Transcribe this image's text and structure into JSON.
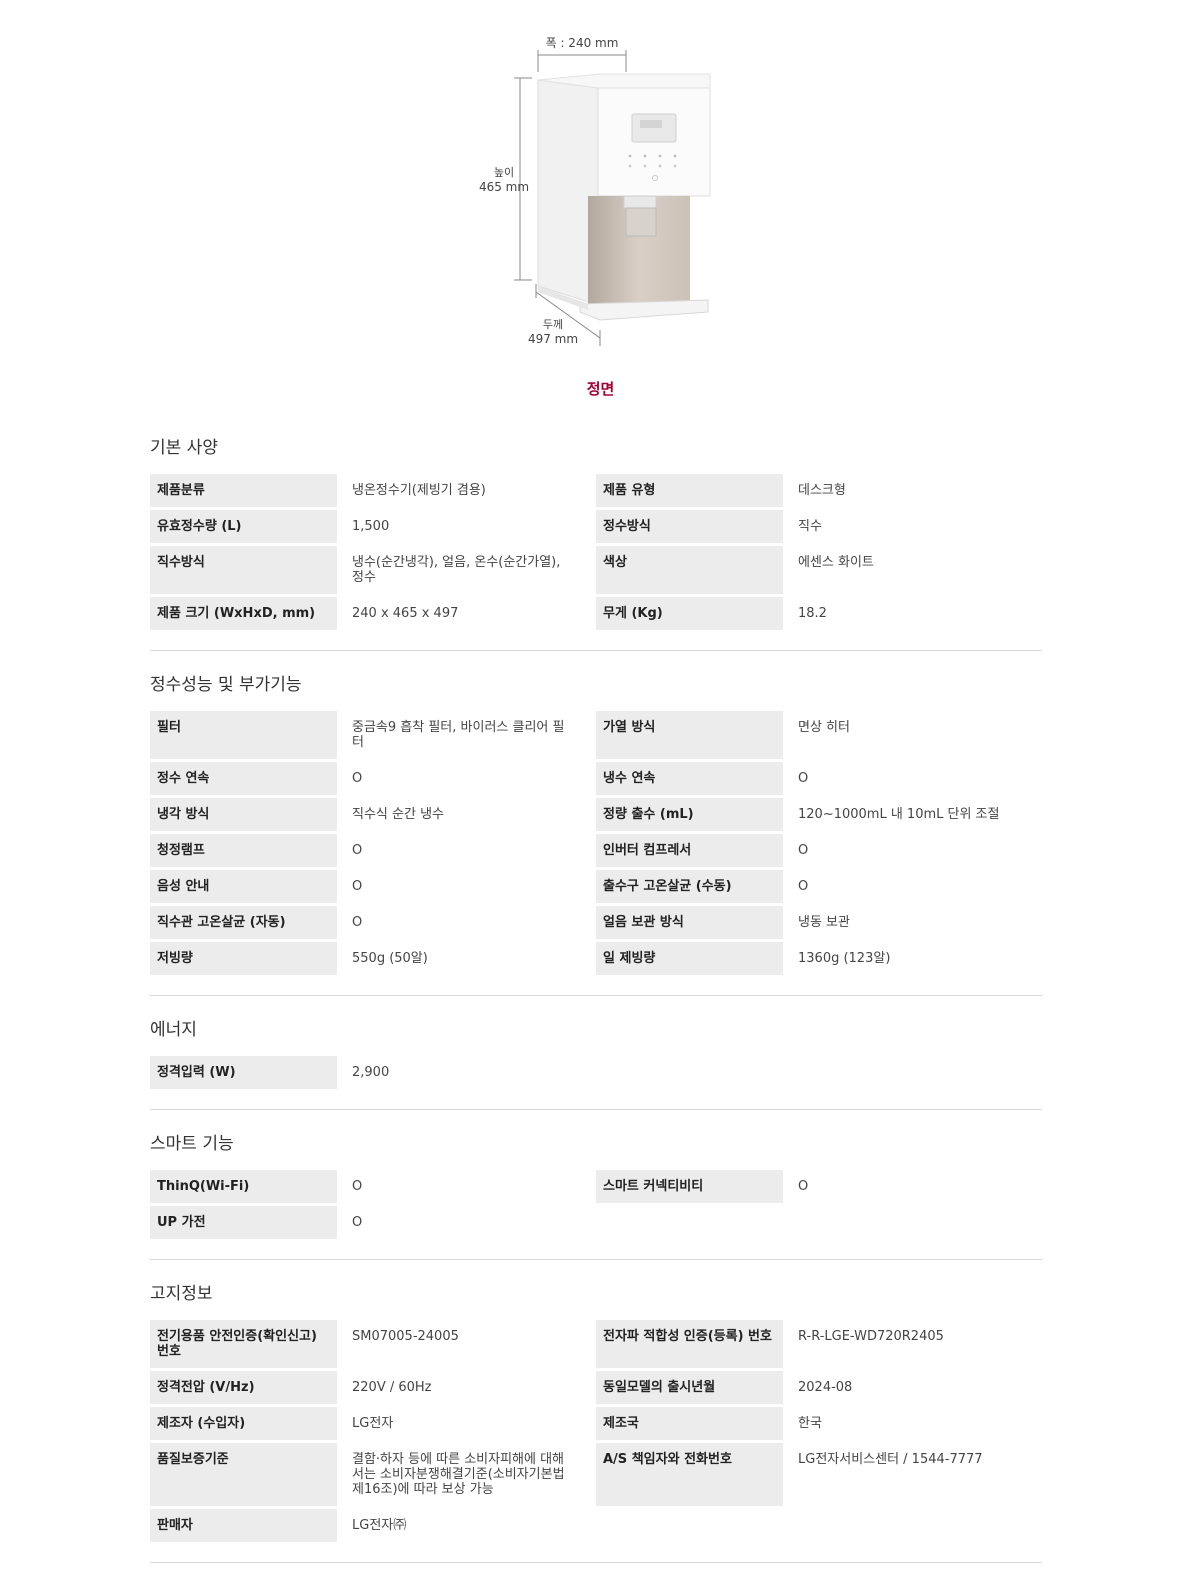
{
  "figure": {
    "width_label": "폭 : 240 mm",
    "height_label_top": "높이",
    "height_label_value": "465 mm",
    "depth_label_top": "두께",
    "depth_label_value": "497 mm",
    "caption": "정면",
    "accent_color": "#a50034"
  },
  "sections": [
    {
      "title": "기본 사양",
      "rows": [
        [
          "제품분류",
          "냉온정수기(제빙기 겸용)",
          "제품 유형",
          "데스크형"
        ],
        [
          "유효정수량 (L)",
          "1,500",
          "정수방식",
          "직수"
        ],
        [
          "직수방식",
          "냉수(순간냉각), 얼음, 온수(순간가열), 정수",
          "색상",
          "에센스 화이트"
        ],
        [
          "제품 크기 (WxHxD, mm)",
          "240 x 465 x 497",
          "무게 (Kg)",
          "18.2"
        ]
      ]
    },
    {
      "title": "정수성능 및 부가기능",
      "rows": [
        [
          "필터",
          "중금속9 흡착 필터, 바이러스 클리어 필터",
          "가열 방식",
          "면상 히터"
        ],
        [
          "정수 연속",
          "O",
          "냉수 연속",
          "O"
        ],
        [
          "냉각 방식",
          "직수식 순간 냉수",
          "정량 출수 (mL)",
          "120~1000mL 내 10mL 단위 조절"
        ],
        [
          "청정램프",
          "O",
          "인버터 컴프레서",
          "O"
        ],
        [
          "음성 안내",
          "O",
          "출수구 고온살균 (수동)",
          "O"
        ],
        [
          "직수관 고온살균 (자동)",
          "O",
          "얼음 보관 방식",
          "냉동 보관"
        ],
        [
          "저빙량",
          "550g (50알)",
          "일 제빙량",
          "1360g (123알)"
        ]
      ]
    },
    {
      "title": "에너지",
      "rows": [
        [
          "정격입력 (W)",
          "2,900",
          "",
          ""
        ]
      ]
    },
    {
      "title": "스마트 기능",
      "rows": [
        [
          "ThinQ(Wi-Fi)",
          "O",
          "스마트 커넥티비티",
          "O"
        ],
        [
          "UP 가전",
          "O",
          "",
          ""
        ]
      ]
    },
    {
      "title": "고지정보",
      "rows": [
        [
          "전기용품 안전인증(확인신고) 번호",
          "SM07005-24005",
          "전자파 적합성 인증(등록) 번호",
          "R-R-LGE-WD720R2405"
        ],
        [
          "정격전압 (V/Hz)",
          "220V / 60Hz",
          "동일모델의 출시년월",
          "2024-08"
        ],
        [
          "제조자 (수입자)",
          "LG전자",
          "제조국",
          "한국"
        ],
        [
          "품질보증기준",
          "결함·하자 등에 따른 소비자피해에 대해서는 소비자분쟁해결기준(소비자기본법 제16조)에 따라 보상 가능",
          "A/S 책임자와 전화번호",
          "LG전자서비스센터 / 1544-7777"
        ],
        [
          "판매자",
          "LG전자㈜",
          "",
          ""
        ]
      ]
    }
  ]
}
